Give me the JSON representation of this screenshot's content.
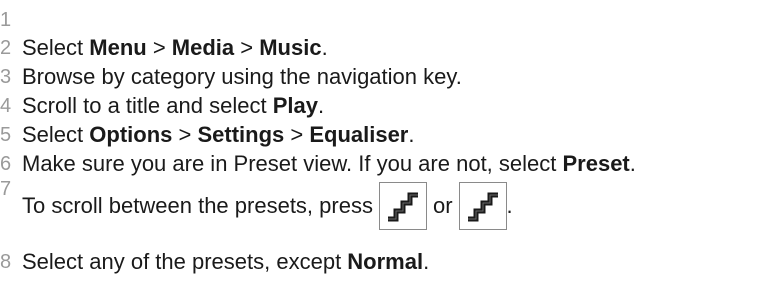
{
  "steps": [
    {
      "number": "1",
      "parts": []
    },
    {
      "number": "2",
      "parts": [
        {
          "t": "Select ",
          "b": false
        },
        {
          "t": "Menu",
          "b": true
        },
        {
          "t": " > ",
          "b": false
        },
        {
          "t": "Media",
          "b": true
        },
        {
          "t": " > ",
          "b": false
        },
        {
          "t": "Music",
          "b": true
        },
        {
          "t": ".",
          "b": false
        }
      ]
    },
    {
      "number": "3",
      "parts": [
        {
          "t": "Browse by category using the navigation key.",
          "b": false
        }
      ]
    },
    {
      "number": "4",
      "parts": [
        {
          "t": "Scroll to a title and select ",
          "b": false
        },
        {
          "t": "Play",
          "b": true
        },
        {
          "t": ".",
          "b": false
        }
      ]
    },
    {
      "number": "5",
      "parts": [
        {
          "t": "Select ",
          "b": false
        },
        {
          "t": "Options",
          "b": true
        },
        {
          "t": " > ",
          "b": false
        },
        {
          "t": "Settings",
          "b": true
        },
        {
          "t": " > ",
          "b": false
        },
        {
          "t": "Equaliser",
          "b": true
        },
        {
          "t": ".",
          "b": false
        }
      ]
    },
    {
      "number": "6",
      "parts": [
        {
          "t": "Make sure you are in Preset view. If you are not, select ",
          "b": false
        },
        {
          "t": "Preset",
          "b": true
        },
        {
          "t": ".",
          "b": false
        }
      ]
    },
    {
      "number": "7",
      "text_before": "To scroll between the presets, press",
      "text_middle": "or",
      "text_after": ".",
      "key_icon_left": "staircase-key-icon",
      "key_icon_right": "staircase-key-icon"
    },
    {
      "number": "8",
      "parts": [
        {
          "t": "Select any of the presets, except ",
          "b": false
        },
        {
          "t": "Normal",
          "b": true
        },
        {
          "t": ".",
          "b": false
        }
      ]
    }
  ]
}
